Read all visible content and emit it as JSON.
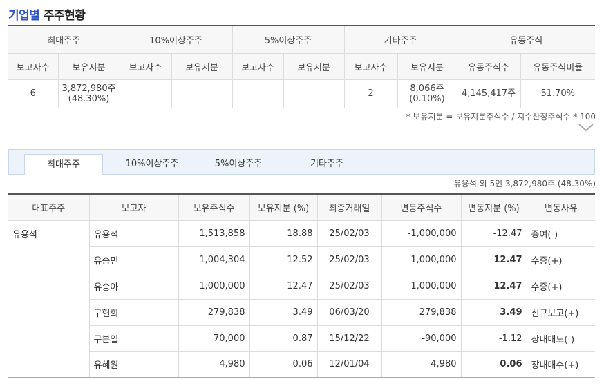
{
  "title": {
    "prefix": "기업별",
    "main": "주주현황"
  },
  "summary": {
    "groups": [
      "최대주주",
      "10%이상주주",
      "5%이상주주",
      "기타주주",
      "유동주식"
    ],
    "subheaders": [
      "보고자수",
      "보유지분",
      "보고자수",
      "보유지분",
      "보고자수",
      "보유지분",
      "보고자수",
      "보유지분",
      "유동주식수",
      "유동주식비율"
    ],
    "row": {
      "max_count": "6",
      "max_share_1": "3,872,980주",
      "max_share_2": "(48.30%)",
      "ten_count": "",
      "ten_share": "",
      "five_count": "",
      "five_share": "",
      "other_count": "2",
      "other_share_1": "8,066주",
      "other_share_2": "(0.10%)",
      "float_shares": "4,145,417주",
      "float_ratio": "51.70%"
    },
    "note": "* 보유지분 = 보유지분주식수 / 지수산정주식수 * 100"
  },
  "tabs": [
    {
      "label": "최대주주",
      "active": true
    },
    {
      "label": "10%이상주주",
      "active": false
    },
    {
      "label": "5%이상주주",
      "active": false
    },
    {
      "label": "기타주주",
      "active": false
    }
  ],
  "detail_note": "유용석 외 5인 3,872,980주 (48.30%)",
  "detail": {
    "headers": [
      "대표주주",
      "보고자",
      "보유주식수",
      "보유지분 (%)",
      "최종거래일",
      "변동주식수",
      "변동지분 (%)",
      "변동사유"
    ],
    "rows": [
      {
        "rep": "유용석",
        "reporter": "유용석",
        "shares": "1,513,858",
        "pct": "18.88",
        "date": "25/02/03",
        "chg": "-1,000,000",
        "chg_pct": "-12.47",
        "reason": "증여(-)"
      },
      {
        "rep": "",
        "reporter": "유승민",
        "shares": "1,004,304",
        "pct": "12.52",
        "date": "25/02/03",
        "chg": "1,000,000",
        "chg_pct": "12.47",
        "reason": "수증(+)"
      },
      {
        "rep": "",
        "reporter": "유승아",
        "shares": "1,000,000",
        "pct": "12.47",
        "date": "25/02/03",
        "chg": "1,000,000",
        "chg_pct": "12.47",
        "reason": "수증(+)"
      },
      {
        "rep": "",
        "reporter": "구현희",
        "shares": "279,838",
        "pct": "3.49",
        "date": "06/03/20",
        "chg": "279,838",
        "chg_pct": "3.49",
        "reason": "신규보고(+)"
      },
      {
        "rep": "",
        "reporter": "구본일",
        "shares": "70,000",
        "pct": "0.87",
        "date": "15/12/22",
        "chg": "-90,000",
        "chg_pct": "-1.12",
        "reason": "장내매도(-)"
      },
      {
        "rep": "",
        "reporter": "유혜원",
        "shares": "4,980",
        "pct": "0.06",
        "date": "12/01/04",
        "chg": "4,980",
        "chg_pct": "0.06",
        "reason": "장내매수(+)"
      }
    ]
  },
  "colors": {
    "accent": "#2f55c4",
    "negative": "#d0202a",
    "tab_bg": "#edf3fa"
  },
  "icons": {
    "expand": "chevron-down-icon"
  }
}
